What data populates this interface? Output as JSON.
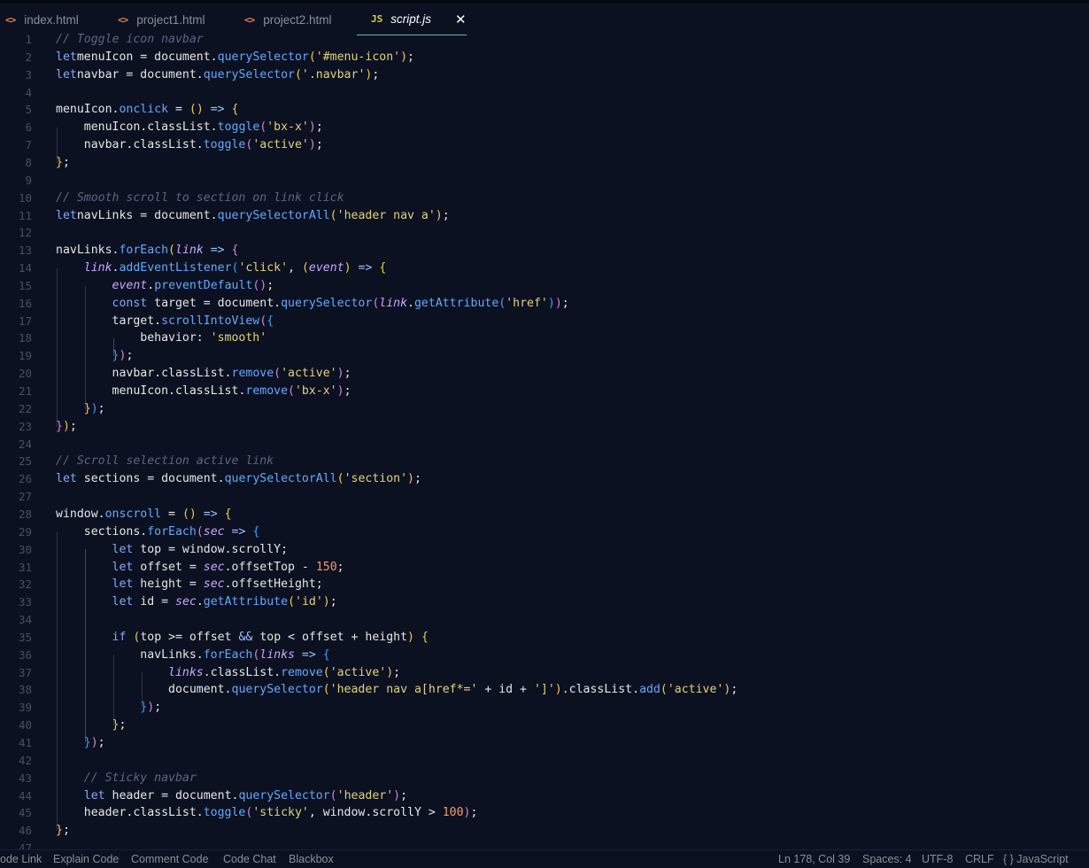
{
  "tabs": [
    {
      "label": "index.html",
      "icon": "<>"
    },
    {
      "label": "project1.html",
      "icon": "<>"
    },
    {
      "label": "project2.html",
      "icon": "<>"
    },
    {
      "label": "script.js",
      "icon": "JS",
      "active": true
    }
  ],
  "tab_close": "✕",
  "code_lines": [
    [
      [
        "c-com",
        "// Toggle icon navbar"
      ]
    ],
    [
      [
        "c-kw",
        "let"
      ],
      [
        "",
        "menuIcon = document."
      ],
      [
        "c-fn",
        "querySelector"
      ],
      [
        "c-p1",
        "("
      ],
      [
        "c-str",
        "'#menu-icon'"
      ],
      [
        "c-p1",
        ")"
      ],
      [
        "",
        ";"
      ]
    ],
    [
      [
        "c-kw",
        "let"
      ],
      [
        "",
        "navbar = document."
      ],
      [
        "c-fn",
        "querySelector"
      ],
      [
        "c-p1",
        "("
      ],
      [
        "c-str",
        "'.navbar'"
      ],
      [
        "c-p1",
        ")"
      ],
      [
        "",
        ";"
      ]
    ],
    [],
    [
      [
        "",
        "menuIcon."
      ],
      [
        "c-fn",
        "onclick"
      ],
      [
        "",
        " = "
      ],
      [
        "c-p1",
        "()"
      ],
      [
        "c-op",
        " =>"
      ],
      [
        "",
        " "
      ],
      [
        "c-p1",
        "{"
      ]
    ],
    [
      [
        "",
        "    menuIcon.classList."
      ],
      [
        "c-fn",
        "toggle"
      ],
      [
        "c-p2",
        "("
      ],
      [
        "c-str",
        "'bx-x'"
      ],
      [
        "c-p2",
        ")"
      ],
      [
        "",
        ";"
      ]
    ],
    [
      [
        "",
        "    navbar.classList."
      ],
      [
        "c-fn",
        "toggle"
      ],
      [
        "c-p2",
        "("
      ],
      [
        "c-str",
        "'active'"
      ],
      [
        "c-p2",
        ")"
      ],
      [
        "",
        ";"
      ]
    ],
    [
      [
        "c-p1",
        "}"
      ],
      [
        "",
        ";"
      ]
    ],
    [],
    [
      [
        "c-com",
        "// Smooth scroll to section on link click"
      ]
    ],
    [
      [
        "c-kw",
        "let"
      ],
      [
        "",
        "navLinks = document."
      ],
      [
        "c-fn",
        "querySelectorAll"
      ],
      [
        "c-p1",
        "("
      ],
      [
        "c-str",
        "'header nav a'"
      ],
      [
        "c-p1",
        ")"
      ],
      [
        "",
        ";"
      ]
    ],
    [],
    [
      [
        "",
        "navLinks."
      ],
      [
        "c-fn",
        "forEach"
      ],
      [
        "c-p1",
        "("
      ],
      [
        "c-par",
        "link"
      ],
      [
        "c-op",
        " =>"
      ],
      [
        "",
        " "
      ],
      [
        "c-p2",
        "{"
      ]
    ],
    [
      [
        "",
        "    "
      ],
      [
        "c-par",
        "link"
      ],
      [
        "",
        "."
      ],
      [
        "c-fn",
        "addEventListener"
      ],
      [
        "c-p3",
        "("
      ],
      [
        "c-str",
        "'click'"
      ],
      [
        "",
        ", "
      ],
      [
        "c-p1",
        "("
      ],
      [
        "c-par",
        "event"
      ],
      [
        "c-p1",
        ")"
      ],
      [
        "c-op",
        " =>"
      ],
      [
        "",
        " "
      ],
      [
        "c-p1",
        "{"
      ]
    ],
    [
      [
        "",
        "        "
      ],
      [
        "c-par",
        "event"
      ],
      [
        "",
        "."
      ],
      [
        "c-fn",
        "preventDefault"
      ],
      [
        "c-p2",
        "()"
      ],
      [
        "",
        ";"
      ]
    ],
    [
      [
        "",
        "        "
      ],
      [
        "c-kw",
        "const"
      ],
      [
        "",
        " target = document."
      ],
      [
        "c-fn",
        "querySelector"
      ],
      [
        "c-p2",
        "("
      ],
      [
        "c-par",
        "link"
      ],
      [
        "",
        "."
      ],
      [
        "c-fn",
        "getAttribute"
      ],
      [
        "c-p3",
        "("
      ],
      [
        "c-str",
        "'href'"
      ],
      [
        "c-p3",
        ")"
      ],
      [
        "c-p2",
        ")"
      ],
      [
        "",
        ";"
      ]
    ],
    [
      [
        "",
        "        target."
      ],
      [
        "c-fn",
        "scrollIntoView"
      ],
      [
        "c-p2",
        "("
      ],
      [
        "c-p3",
        "{"
      ]
    ],
    [
      [
        "",
        "            behavior: "
      ],
      [
        "c-str",
        "'smooth'"
      ]
    ],
    [
      [
        "",
        "        "
      ],
      [
        "c-p3",
        "}"
      ],
      [
        "c-p2",
        ")"
      ],
      [
        "",
        ";"
      ]
    ],
    [
      [
        "",
        "        navbar.classList."
      ],
      [
        "c-fn",
        "remove"
      ],
      [
        "c-p2",
        "("
      ],
      [
        "c-str",
        "'active'"
      ],
      [
        "c-p2",
        ")"
      ],
      [
        "",
        ";"
      ]
    ],
    [
      [
        "",
        "        menuIcon.classList."
      ],
      [
        "c-fn",
        "remove"
      ],
      [
        "c-p2",
        "("
      ],
      [
        "c-str",
        "'bx-x'"
      ],
      [
        "c-p2",
        ")"
      ],
      [
        "",
        ";"
      ]
    ],
    [
      [
        "",
        "    "
      ],
      [
        "c-p1",
        "}"
      ],
      [
        "c-p3",
        ")"
      ],
      [
        "",
        ";"
      ]
    ],
    [
      [
        "c-p2",
        "}"
      ],
      [
        "c-p1",
        ")"
      ],
      [
        "",
        ";"
      ]
    ],
    [],
    [
      [
        "c-com",
        "// Scroll selection active link"
      ]
    ],
    [
      [
        "c-kw",
        "let"
      ],
      [
        "",
        " sections = document."
      ],
      [
        "c-fn",
        "querySelectorAll"
      ],
      [
        "c-p1",
        "("
      ],
      [
        "c-str",
        "'section'"
      ],
      [
        "c-p1",
        ")"
      ],
      [
        "",
        ";"
      ]
    ],
    [],
    [
      [
        "",
        "window."
      ],
      [
        "c-fn",
        "onscroll"
      ],
      [
        "",
        " = "
      ],
      [
        "c-p1",
        "()"
      ],
      [
        "c-op",
        " =>"
      ],
      [
        "",
        " "
      ],
      [
        "c-p1",
        "{"
      ]
    ],
    [
      [
        "",
        "    sections."
      ],
      [
        "c-fn",
        "forEach"
      ],
      [
        "c-p2",
        "("
      ],
      [
        "c-par",
        "sec"
      ],
      [
        "c-op",
        " =>"
      ],
      [
        "",
        " "
      ],
      [
        "c-p3",
        "{"
      ]
    ],
    [
      [
        "",
        "        "
      ],
      [
        "c-kw",
        "let"
      ],
      [
        "",
        " top = window.scrollY;"
      ]
    ],
    [
      [
        "",
        "        "
      ],
      [
        "c-kw",
        "let"
      ],
      [
        "",
        " offset = "
      ],
      [
        "c-par",
        "sec"
      ],
      [
        "",
        ".offsetTop - "
      ],
      [
        "c-num",
        "150"
      ],
      [
        "",
        ";"
      ]
    ],
    [
      [
        "",
        "        "
      ],
      [
        "c-kw",
        "let"
      ],
      [
        "",
        " height = "
      ],
      [
        "c-par",
        "sec"
      ],
      [
        "",
        ".offsetHeight;"
      ]
    ],
    [
      [
        "",
        "        "
      ],
      [
        "c-kw",
        "let"
      ],
      [
        "",
        " id = "
      ],
      [
        "c-par",
        "sec"
      ],
      [
        "",
        "."
      ],
      [
        "c-fn",
        "getAttribute"
      ],
      [
        "c-p1",
        "("
      ],
      [
        "c-str",
        "'id'"
      ],
      [
        "c-p1",
        ")"
      ],
      [
        "",
        ";"
      ]
    ],
    [],
    [
      [
        "",
        "        "
      ],
      [
        "c-kw",
        "if"
      ],
      [
        "",
        " "
      ],
      [
        "c-p1",
        "("
      ],
      [
        "",
        "top >= offset "
      ],
      [
        "c-op",
        "&&"
      ],
      [
        "",
        " top < offset + height"
      ],
      [
        "c-p1",
        ")"
      ],
      [
        "",
        " "
      ],
      [
        "c-p1",
        "{"
      ]
    ],
    [
      [
        "",
        "            navLinks."
      ],
      [
        "c-fn",
        "forEach"
      ],
      [
        "c-p2",
        "("
      ],
      [
        "c-par",
        "links"
      ],
      [
        "c-op",
        " =>"
      ],
      [
        "",
        " "
      ],
      [
        "c-p3",
        "{"
      ]
    ],
    [
      [
        "",
        "                "
      ],
      [
        "c-par",
        "links"
      ],
      [
        "",
        ".classList."
      ],
      [
        "c-fn",
        "remove"
      ],
      [
        "c-p1",
        "("
      ],
      [
        "c-str",
        "'active'"
      ],
      [
        "c-p1",
        ")"
      ],
      [
        "",
        ";"
      ]
    ],
    [
      [
        "",
        "                document."
      ],
      [
        "c-fn",
        "querySelector"
      ],
      [
        "c-p1",
        "("
      ],
      [
        "c-str",
        "'header nav a[href*='"
      ],
      [
        "",
        " + id + "
      ],
      [
        "c-str",
        "']'"
      ],
      [
        "c-p1",
        ")"
      ],
      [
        "",
        ".classList."
      ],
      [
        "c-fn",
        "add"
      ],
      [
        "c-p1",
        "("
      ],
      [
        "c-str",
        "'active'"
      ],
      [
        "c-p1",
        ")"
      ],
      [
        "",
        ";"
      ]
    ],
    [
      [
        "",
        "            "
      ],
      [
        "c-p3",
        "}"
      ],
      [
        "c-p2",
        ")"
      ],
      [
        "",
        ";"
      ]
    ],
    [
      [
        "",
        "        "
      ],
      [
        "c-p1",
        "}"
      ],
      [
        "",
        ";"
      ]
    ],
    [
      [
        "",
        "    "
      ],
      [
        "c-p3",
        "}"
      ],
      [
        "c-p2",
        ")"
      ],
      [
        "",
        ";"
      ]
    ],
    [],
    [
      [
        "",
        "    "
      ],
      [
        "c-com",
        "// Sticky navbar"
      ]
    ],
    [
      [
        "",
        "    "
      ],
      [
        "c-kw",
        "let"
      ],
      [
        "",
        " header = document."
      ],
      [
        "c-fn",
        "querySelector"
      ],
      [
        "c-p2",
        "("
      ],
      [
        "c-str",
        "'header'"
      ],
      [
        "c-p2",
        ")"
      ],
      [
        "",
        ";"
      ]
    ],
    [
      [
        "",
        "    header.classList."
      ],
      [
        "c-fn",
        "toggle"
      ],
      [
        "c-p2",
        "("
      ],
      [
        "c-str",
        "'sticky'"
      ],
      [
        "",
        ", window.scrollY > "
      ],
      [
        "c-num",
        "100"
      ],
      [
        "c-p2",
        ")"
      ],
      [
        "",
        ";"
      ]
    ],
    [
      [
        "c-p1",
        "}"
      ],
      [
        "",
        ";"
      ]
    ],
    []
  ],
  "status_left": [
    "ode Link",
    "Explain Code",
    "Comment Code",
    "Code Chat",
    "Blackbox"
  ],
  "status_right": [
    "Ln 178, Col 39",
    "Spaces: 4",
    "UTF-8",
    "CRLF",
    "{ } JavaScript"
  ]
}
